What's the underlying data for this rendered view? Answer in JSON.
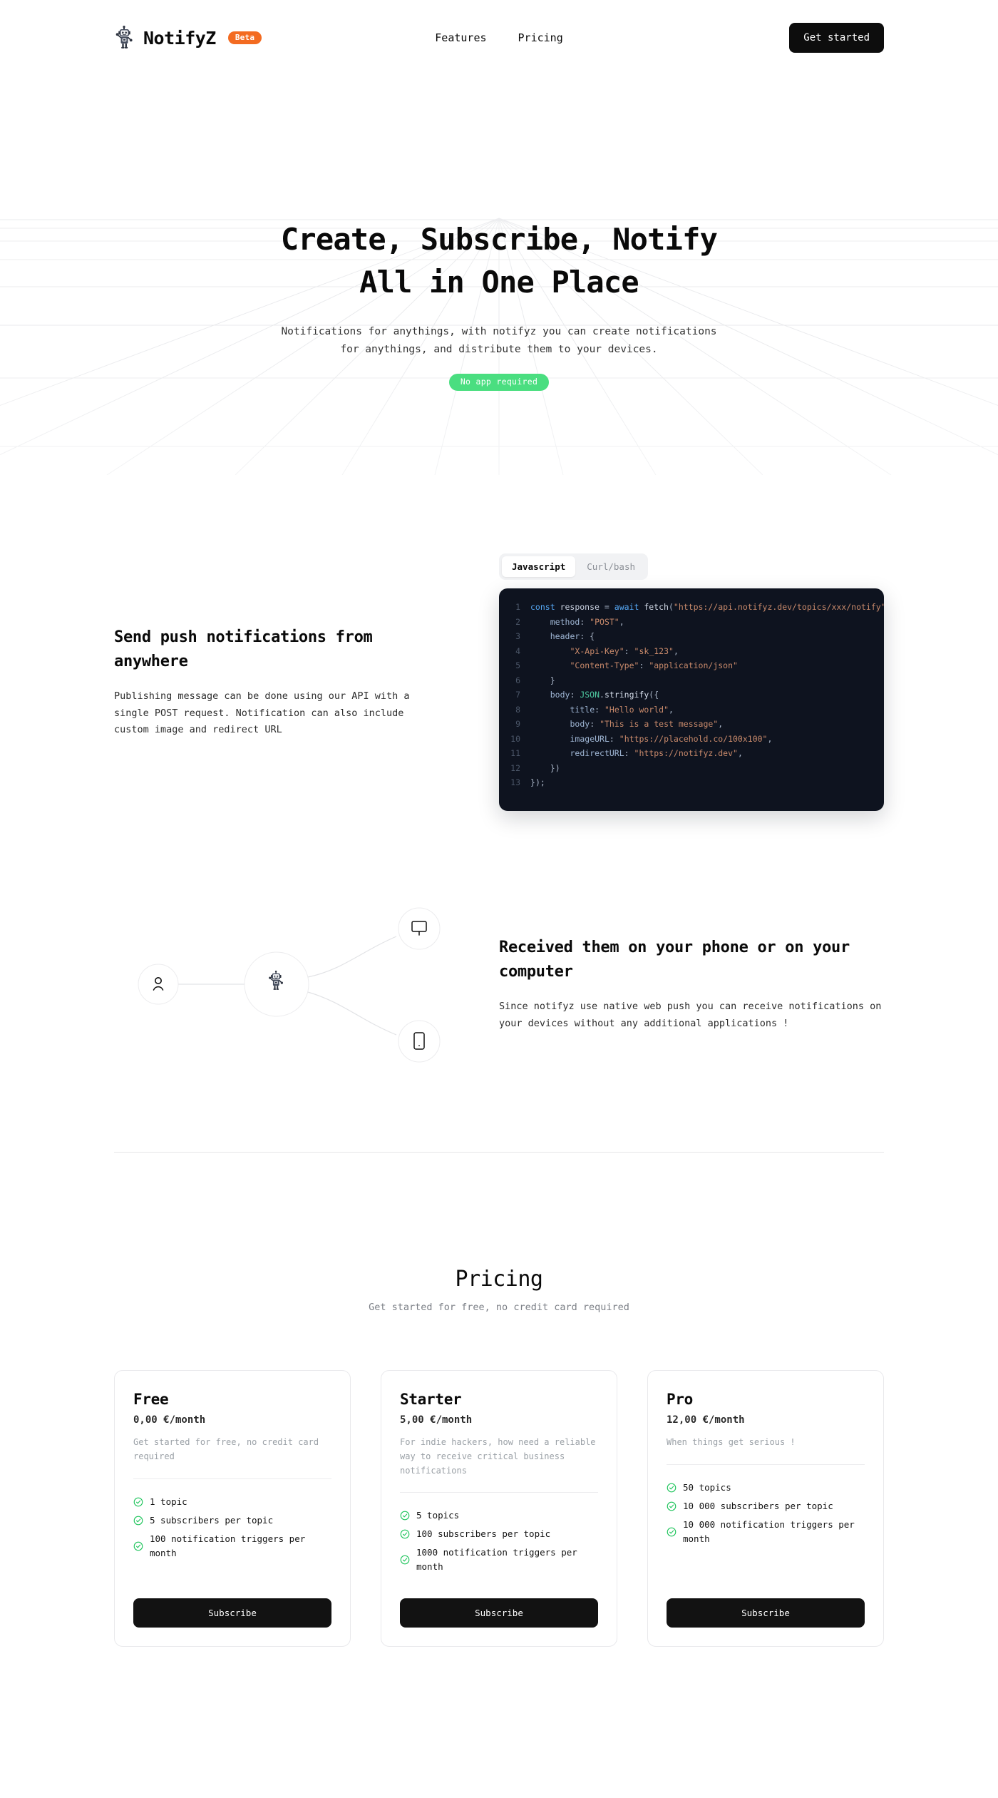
{
  "header": {
    "brand_name": "NotifyZ",
    "brand_badge": "Beta",
    "logo_icon": "robot-icon",
    "nav": [
      {
        "label": "Features"
      },
      {
        "label": "Pricing"
      }
    ],
    "cta_label": "Get started"
  },
  "hero": {
    "title_line1": "Create, Subscribe, Notify",
    "title_line2": "All in One Place",
    "subtitle_line1": "Notifications for anythings, with notifyz you can create notifications",
    "subtitle_line2": "for anythings, and distribute them to your devices.",
    "badge": "No app required",
    "badge_color": "#4ade80"
  },
  "feature_push": {
    "title": "Send push notifications from anywhere",
    "description": "Publishing message can be done using our API with a single POST request. Notification can also include custom image and redirect URL",
    "tabs": [
      {
        "label": "Javascript",
        "active": true
      },
      {
        "label": "Curl/bash",
        "active": false
      }
    ],
    "code": {
      "language": "javascript",
      "lines": [
        {
          "n": "1",
          "text": "const response = await fetch(\"https://api.notifyz.dev/topics/xxx/notify\", {"
        },
        {
          "n": "2",
          "text": "    method: \"POST\","
        },
        {
          "n": "3",
          "text": "    header: {"
        },
        {
          "n": "4",
          "text": "        \"X-Api-Key\": \"sk_123\","
        },
        {
          "n": "5",
          "text": "        \"Content-Type\": \"application/json\""
        },
        {
          "n": "6",
          "text": "    }"
        },
        {
          "n": "7",
          "text": "    body: JSON.stringify({"
        },
        {
          "n": "8",
          "text": "        title: \"Hello world\","
        },
        {
          "n": "9",
          "text": "        body: \"This is a test message\","
        },
        {
          "n": "10",
          "text": "        imageURL: \"https://placehold.co/100x100\","
        },
        {
          "n": "11",
          "text": "        redirectURL: \"https://notifyz.dev\","
        },
        {
          "n": "12",
          "text": "    })"
        },
        {
          "n": "13",
          "text": "});"
        }
      ]
    }
  },
  "feature_receive": {
    "title": "Received them on your phone or on your computer",
    "description": "Since notifyz use native web push you can receive notifications on your devices without any additional applications !",
    "diagram": {
      "nodes": [
        {
          "icon": "user-icon"
        },
        {
          "icon": "robot-icon"
        },
        {
          "icon": "monitor-icon"
        },
        {
          "icon": "phone-icon"
        }
      ]
    }
  },
  "pricing": {
    "title": "Pricing",
    "subtitle": "Get started for free, no credit card required",
    "plans": [
      {
        "name": "Free",
        "price": "0,00 €/month",
        "description": "Get started for free, no credit card required",
        "features": [
          "1 topic",
          "5 subscribers per topic",
          "100 notification triggers per month"
        ],
        "cta": "Subscribe"
      },
      {
        "name": "Starter",
        "price": "5,00 €/month",
        "description": "For indie hackers, how need a reliable way to receive critical business notifications",
        "features": [
          "5 topics",
          "100 subscribers per topic",
          "1000 notification triggers per month"
        ],
        "cta": "Subscribe"
      },
      {
        "name": "Pro",
        "price": "12,00 €/month",
        "description": "When things get serious !",
        "features": [
          "50 topics",
          "10 000 subscribers per topic",
          "10 000 notification triggers per month"
        ],
        "cta": "Subscribe"
      }
    ],
    "check_color": "#22c55e"
  }
}
